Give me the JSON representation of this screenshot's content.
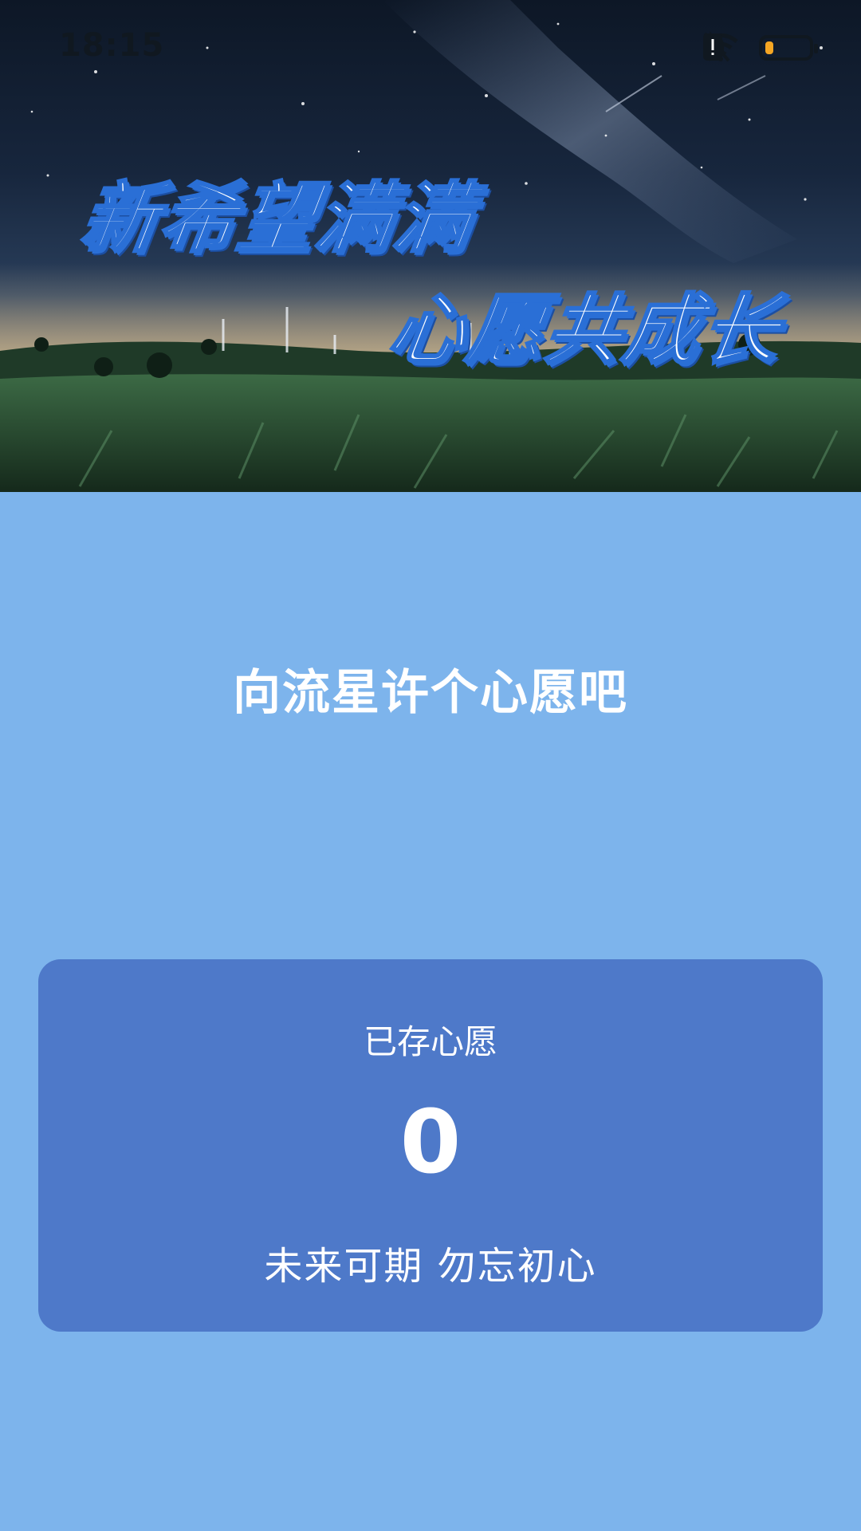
{
  "status_bar": {
    "time": "18:15",
    "icons": [
      "bluetooth-icon",
      "bell-muted-icon",
      "wifi-icon",
      "sim-alert-icon",
      "battery-icon"
    ],
    "battery_level": 0.2
  },
  "hero": {
    "title_line1": "新希望满满",
    "title_line2": "心愿共成长"
  },
  "main": {
    "prompt": "向流星许个心愿吧"
  },
  "card": {
    "label": "已存心愿",
    "count": "0",
    "motto": "未来可期 勿忘初心"
  },
  "colors": {
    "background": "#7db4ec",
    "card": "#4e79c9",
    "title_stroke": "#2a6fd6",
    "battery": "#f5a623"
  }
}
